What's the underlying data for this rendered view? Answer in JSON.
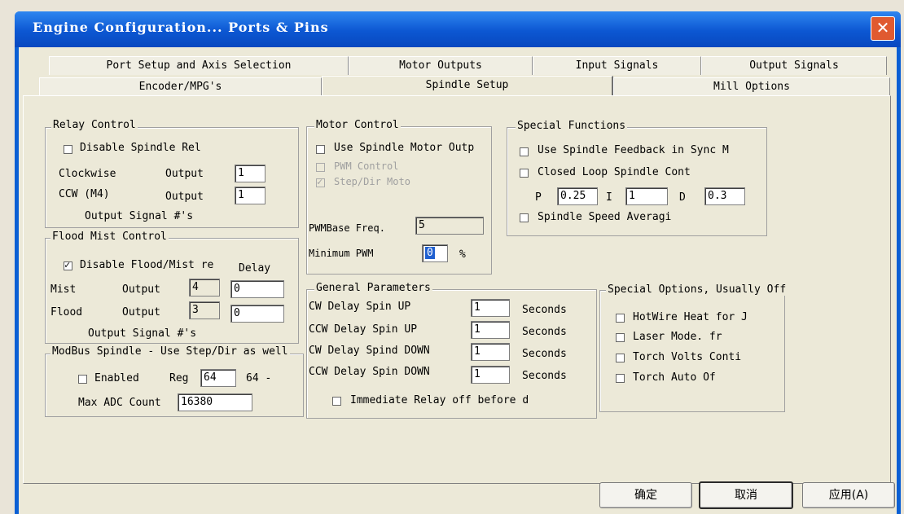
{
  "window": {
    "title": "Engine Configuration... Ports & Pins",
    "close_label": "✕"
  },
  "tabs": {
    "row1": [
      "Port Setup and Axis Selection",
      "Motor Outputs",
      "Input Signals",
      "Output Signals"
    ],
    "row2": [
      "Encoder/MPG's",
      "Spindle Setup",
      "Mill Options"
    ],
    "active": "Spindle Setup"
  },
  "relay": {
    "legend": "Relay Control",
    "disable": {
      "label": "Disable Spindle Rel",
      "checked": false
    },
    "cw_label": "Clockwise",
    "cw_output_label": "Output",
    "cw_value": "1",
    "ccw_label": "CCW (M4)",
    "ccw_output_label": "Output",
    "ccw_value": "1",
    "footer": "Output Signal #'s"
  },
  "flood": {
    "legend": "Flood Mist Control",
    "disable": {
      "label": "Disable Flood/Mist re",
      "checked": true
    },
    "delay_label": "Delay",
    "mist_label": "Mist",
    "mist_output_label": "Output",
    "mist_value": "4",
    "mist_delay": "0",
    "flood_label": "Flood",
    "flood_output_label": "Output",
    "flood_value": "3",
    "flood_delay": "0",
    "footer": "Output Signal #'s"
  },
  "modbus": {
    "legend": "ModBus Spindle - Use Step/Dir as well",
    "enabled": {
      "label": "Enabled",
      "checked": false
    },
    "reg_label": "Reg",
    "reg_value": "64",
    "reg_suffix": "64 -",
    "max_adc_label": "Max ADC Count",
    "max_adc_value": "16380"
  },
  "motor": {
    "legend": "Motor Control",
    "use_spindle": {
      "label": "Use Spindle Motor Outp",
      "checked": false
    },
    "pwm_control": {
      "label": "PWM Control",
      "checked": false
    },
    "step_dir": {
      "label": "Step/Dir Moto",
      "checked": true
    },
    "pwm_base_label": "PWMBase Freq.",
    "pwm_base_value": "5",
    "min_pwm_label": "Minimum PWM",
    "min_pwm_value": "0",
    "min_pwm_unit": "%"
  },
  "special_functions": {
    "legend": "Special Functions",
    "feedback": {
      "label": "Use Spindle Feedback in Sync M",
      "checked": false
    },
    "closed_loop": {
      "label": "Closed Loop Spindle Cont",
      "checked": false
    },
    "p_label": "P",
    "p_value": "0.25",
    "i_label": "I",
    "i_value": "1",
    "d_label": "D",
    "d_value": "0.3",
    "averaging": {
      "label": "Spindle Speed Averagi",
      "checked": false
    }
  },
  "general": {
    "legend": "General Parameters",
    "rows": [
      {
        "label": "CW Delay Spin UP",
        "value": "1",
        "unit": "Seconds"
      },
      {
        "label": "CCW Delay Spin UP",
        "value": "1",
        "unit": "Seconds"
      },
      {
        "label": "CW Delay Spind DOWN",
        "value": "1",
        "unit": "Seconds"
      },
      {
        "label": "CCW Delay Spin DOWN",
        "value": "1",
        "unit": "Seconds"
      }
    ],
    "immediate": {
      "label": "Immediate Relay off before d",
      "checked": false
    }
  },
  "special_options": {
    "legend": "Special Options, Usually Off",
    "items": [
      {
        "label": "HotWire Heat for J",
        "checked": false
      },
      {
        "label": "Laser Mode. fr",
        "checked": false
      },
      {
        "label": "Torch Volts Conti",
        "checked": false
      },
      {
        "label": "Torch Auto Of",
        "checked": false
      }
    ]
  },
  "buttons": {
    "ok": "确定",
    "cancel": "取消",
    "apply": "应用(A)"
  }
}
